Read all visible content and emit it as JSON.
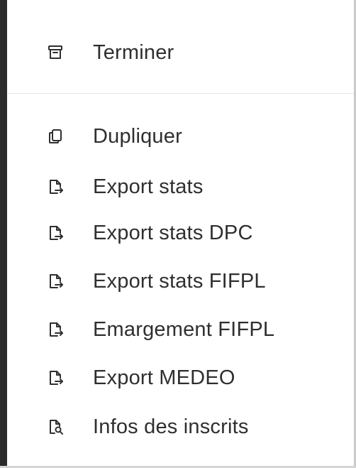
{
  "menu": {
    "top_items": [
      {
        "label": "Terminer",
        "icon": "archive-icon"
      }
    ],
    "items": [
      {
        "label": "Dupliquer",
        "icon": "copy-icon"
      },
      {
        "label": "Export stats",
        "icon": "file-export-icon"
      },
      {
        "label": "Export stats DPC",
        "icon": "file-export-icon"
      },
      {
        "label": "Export stats FIFPL",
        "icon": "file-export-icon"
      },
      {
        "label": "Emargement FIFPL",
        "icon": "file-export-icon"
      },
      {
        "label": "Export MEDEO",
        "icon": "file-export-icon"
      },
      {
        "label": "Infos des inscrits",
        "icon": "file-search-icon"
      }
    ]
  },
  "colors": {
    "text": "#2f2f2f",
    "divider": "#e6e6e6",
    "background": "#ffffff"
  }
}
